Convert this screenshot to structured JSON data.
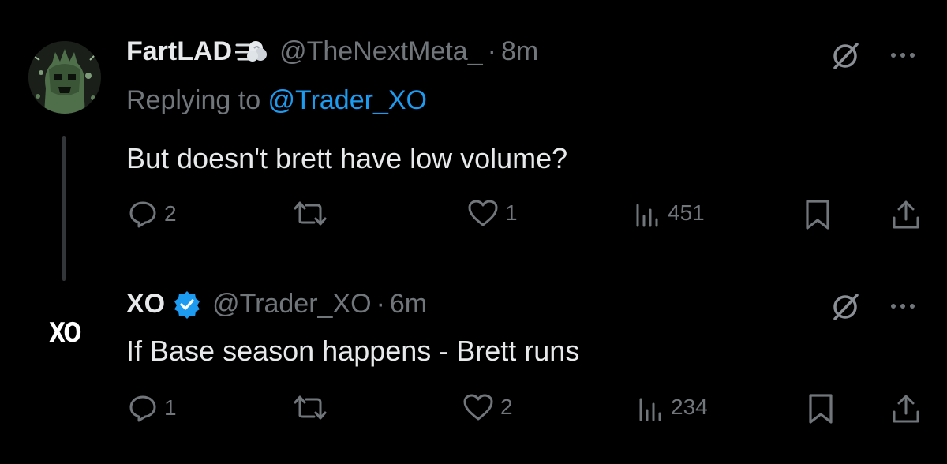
{
  "tweets": [
    {
      "author": "FartLAD",
      "handle": "@TheNextMeta_",
      "time": "8m",
      "replying_prefix": "Replying to ",
      "replying_to": "@Trader_XO",
      "text": "But doesn't brett have low volume?",
      "replies": "2",
      "likes": "1",
      "views": "451",
      "avatar_desc": "green-skull-avatar"
    },
    {
      "author": "XO",
      "handle": "@Trader_XO",
      "time": "6m",
      "text": "If Base season happens - Brett runs",
      "replies": "1",
      "likes": "2",
      "views": "234",
      "avatar_text": "XO"
    }
  ],
  "separator": "·",
  "colors": {
    "background": "#000000",
    "text": "#e7e9ea",
    "muted": "#71767b",
    "link": "#1d9bf0",
    "verified": "#1d9bf0"
  },
  "icons": [
    "reply-icon",
    "retweet-icon",
    "like-icon",
    "views-icon",
    "bookmark-icon",
    "share-icon",
    "grok-icon",
    "more-icon",
    "verified-badge-icon",
    "dash-emoji-icon"
  ]
}
